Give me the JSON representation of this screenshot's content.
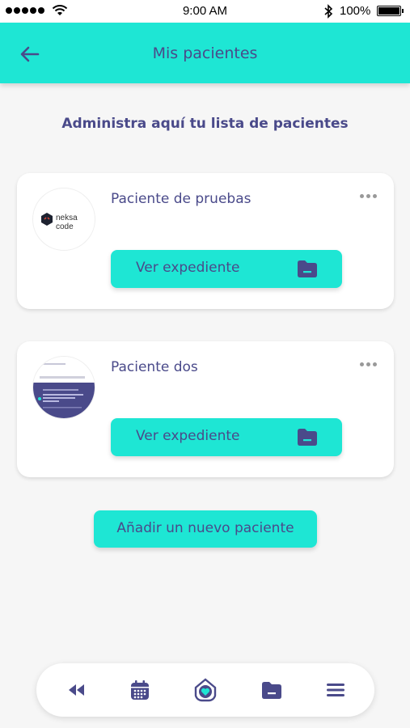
{
  "status_bar": {
    "time": "9:00 AM",
    "battery": "100%"
  },
  "header": {
    "title": "Mis pacientes",
    "back_icon": "arrow-left-icon"
  },
  "subtitle": "Administra aquí tu lista de pacientes",
  "patients": [
    {
      "name": "Paciente de pruebas",
      "avatar_text": "neksa code",
      "button_label": "Ver expediente"
    },
    {
      "name": "Paciente dos",
      "button_label": "Ver expediente"
    }
  ],
  "add_button_label": "Añadir un nuevo paciente",
  "nav": {
    "items": [
      "rewind-icon",
      "calendar-icon",
      "home-heart-icon",
      "folder-icon",
      "menu-icon"
    ]
  },
  "colors": {
    "accent": "#1ee6d4",
    "primary_text": "#4a4a8a",
    "background": "#f6f6f6"
  }
}
